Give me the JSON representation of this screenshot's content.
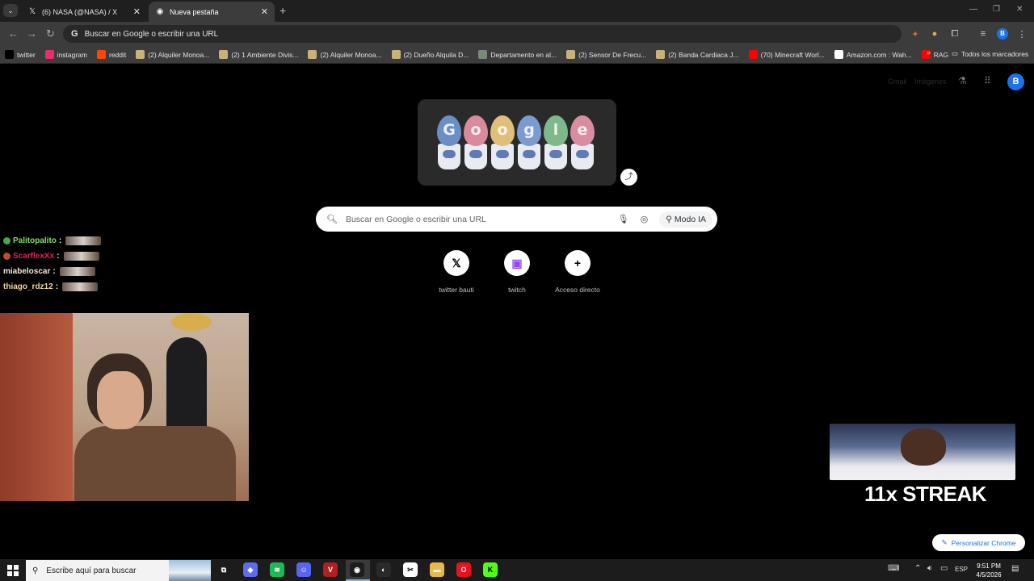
{
  "colors": {
    "chrome_frame": "#1f1f1f",
    "toolbar": "#3c3c3c",
    "page_bg": "#000000",
    "accent_blue": "#1a73e8",
    "chat_user_1": "#7fe05a",
    "chat_user_2": "#e0205a",
    "chat_user_3": "#f2e6d8",
    "chat_user_4": "#f4d79a"
  },
  "tabs": [
    {
      "title": "(6) NASA (@NASA) / X",
      "icon": "x-logo-icon",
      "active": false
    },
    {
      "title": "Nueva pestaña",
      "icon": "chrome-icon",
      "active": true
    }
  ],
  "omnibox": {
    "placeholder": "Buscar en Google o escribir una URL"
  },
  "bookmarks": [
    {
      "label": "twitter",
      "icon": "x-logo-icon",
      "color": "#000000"
    },
    {
      "label": "instagram",
      "icon": "instagram-icon",
      "color": "#e1306c"
    },
    {
      "label": "reddit",
      "icon": "reddit-icon",
      "color": "#ff4500"
    },
    {
      "label": "(2) Alquiler Monoa...",
      "icon": "marketplace-icon",
      "color": "#c9b27a"
    },
    {
      "label": "(2) 1 Ambiente Divis...",
      "icon": "marketplace-icon",
      "color": "#c9b27a"
    },
    {
      "label": "(2) Alquiler Monoa...",
      "icon": "marketplace-icon",
      "color": "#c9b27a"
    },
    {
      "label": "(2) Dueño Alquila D...",
      "icon": "marketplace-icon",
      "color": "#c9b27a"
    },
    {
      "label": "Departamento en al...",
      "icon": "building-icon",
      "color": "#7a8a7a"
    },
    {
      "label": "(2) Sensor De Frecu...",
      "icon": "marketplace-icon",
      "color": "#c9b27a"
    },
    {
      "label": "(2) Banda Cardiaca J...",
      "icon": "marketplace-icon",
      "color": "#c9b27a"
    },
    {
      "label": "(70) Minecraft Worl...",
      "icon": "youtube-icon",
      "color": "#ff0000"
    },
    {
      "label": "Amazon.com : Wah...",
      "icon": "amazon-icon",
      "color": "#ffffff"
    },
    {
      "label": "RAG",
      "icon": "youtube-icon",
      "color": "#ff0000"
    }
  ],
  "bookmarks_more": "»",
  "all_bookmarks": "Todos los marcadores",
  "ntp": {
    "top_links": [
      "Gmail",
      "Imágenes"
    ],
    "avatar_letter": "B",
    "search_placeholder": "Buscar en Google o escribir una URL",
    "modo_ia": "Modo IA",
    "doodle_letters": [
      "G",
      "o",
      "o",
      "g",
      "l",
      "e"
    ],
    "doodle_colors": [
      "#6a8fc7",
      "#d98a9c",
      "#e0bf7a",
      "#7b9bd0",
      "#7fb88a",
      "#d88ea0"
    ],
    "shortcuts": [
      {
        "label": "twitter bauti",
        "icon": "x-logo-icon",
        "glyph": "𝕏"
      },
      {
        "label": "twitch",
        "icon": "twitch-icon",
        "glyph": "▣"
      },
      {
        "label": "Acceso directo",
        "icon": "plus-icon",
        "glyph": "+"
      }
    ],
    "customize_label": "Personalizar Chrome"
  },
  "chat": [
    {
      "user": "Palitopalito",
      "badge": "#46a84a"
    },
    {
      "user": "ScarflexXx",
      "badge": "#c44a2a"
    },
    {
      "user": "miabeloscar",
      "badge": ""
    },
    {
      "user": "thiago_rdz12",
      "badge": ""
    }
  ],
  "streak_text": "11x STREAK",
  "taskbar": {
    "search_placeholder": "Escribe aquí para buscar",
    "apps": [
      {
        "name": "task-view-icon",
        "color": "#1c1c1c",
        "glyph": "⧉"
      },
      {
        "name": "copilot-icon",
        "color": "#5a6cf0",
        "glyph": "◆"
      },
      {
        "name": "spotify-icon",
        "color": "#1db954",
        "glyph": "≋"
      },
      {
        "name": "discord-icon",
        "color": "#5865f2",
        "glyph": "☺"
      },
      {
        "name": "voicemeeter-icon",
        "color": "#b02020",
        "glyph": "V"
      },
      {
        "name": "chrome-icon",
        "color": "#1c1c1c",
        "glyph": "◉"
      },
      {
        "name": "obs-icon",
        "color": "#2a2a2a",
        "glyph": "◐"
      },
      {
        "name": "capcut-icon",
        "color": "#ffffff",
        "glyph": "✂"
      },
      {
        "name": "file-explorer-icon",
        "color": "#e8b84a",
        "glyph": "▬"
      },
      {
        "name": "opera-icon",
        "color": "#e3141e",
        "glyph": "O"
      },
      {
        "name": "kick-icon",
        "color": "#53fc18",
        "glyph": "K"
      }
    ],
    "lang": "ESP",
    "time": "9:51 PM",
    "date": "4/5/2026"
  }
}
